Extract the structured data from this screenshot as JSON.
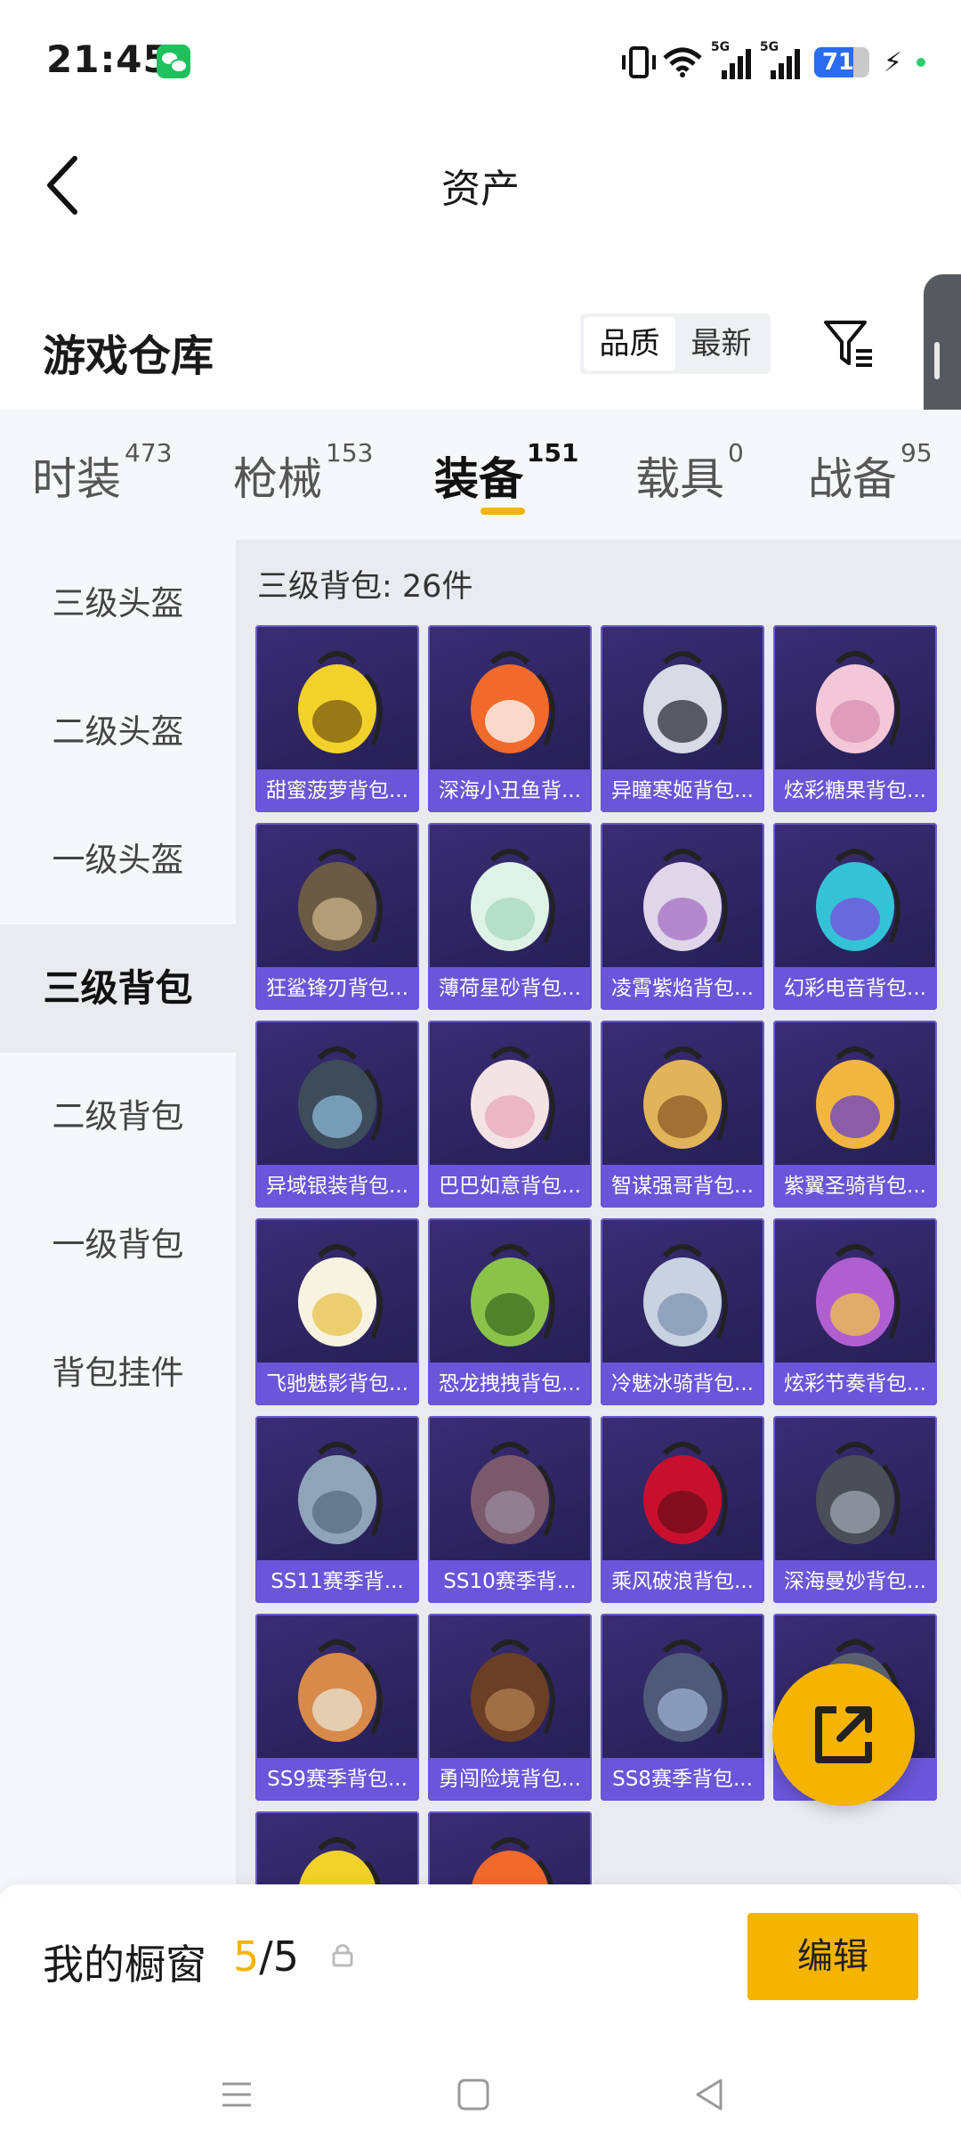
{
  "status_bar": {
    "time": "21:45",
    "network_1": "5G",
    "network_2": "5G",
    "battery": "71",
    "icons": [
      "wechat-icon",
      "vibrate-icon",
      "wifi-icon",
      "signal-icon",
      "signal-icon",
      "battery-icon",
      "charging-icon"
    ]
  },
  "header": {
    "title": "资产"
  },
  "warehouse": {
    "title": "游戏仓库",
    "sort_options": [
      "品质",
      "最新"
    ],
    "active_sort": "品质"
  },
  "tabs": [
    {
      "label": "时装",
      "count": "473"
    },
    {
      "label": "枪械",
      "count": "153"
    },
    {
      "label": "装备",
      "count": "151"
    },
    {
      "label": "载具",
      "count": "0"
    },
    {
      "label": "战备",
      "count": "95"
    }
  ],
  "active_tab": "装备",
  "left_nav": {
    "items": [
      "三级头盔",
      "二级头盔",
      "一级头盔",
      "三级背包",
      "二级背包",
      "一级背包",
      "背包挂件"
    ],
    "active": "三级背包"
  },
  "category_header": "三级背包: 26件",
  "items": [
    "甜蜜菠萝背包...",
    "深海小丑鱼背...",
    "异瞳寒姬背包...",
    "炫彩糖果背包...",
    "狂鲨锋刃背包...",
    "薄荷星砂背包...",
    "凌霄紫焰背包...",
    "幻彩电音背包...",
    "异域银装背包...",
    "巴巴如意背包...",
    "智谋强哥背包...",
    "紫翼圣骑背包...",
    "飞驰魅影背包...",
    "恐龙拽拽背包...",
    "冷魅冰骑背包...",
    "炫彩节奏背包...",
    "SS11赛季背...",
    "SS10赛季背...",
    "乘风破浪背包...",
    "深海曼妙背包...",
    "SS9赛季背包...",
    "勇闯险境背包...",
    "SS8赛季背包...",
    "...包..."
  ],
  "showcase": {
    "label": "我的橱窗",
    "current": "5",
    "separator": "/",
    "total": "5",
    "edit_label": "编辑"
  },
  "colors": {
    "accent": "#f5b400",
    "card_bg": "#2d2460",
    "card_label": "#6b55d8"
  }
}
